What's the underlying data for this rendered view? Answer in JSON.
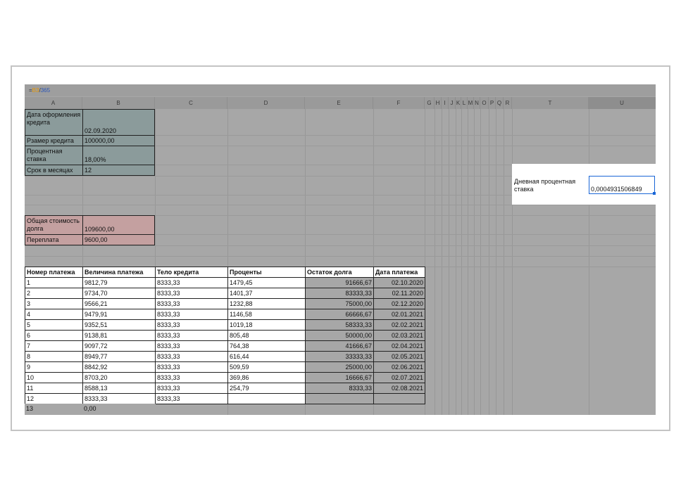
{
  "formula_bar": {
    "eq": "=",
    "ref": "B3",
    "slash": "/",
    "num": "365"
  },
  "columns": [
    "A",
    "B",
    "C",
    "D",
    "E",
    "F",
    "G",
    "H",
    "I",
    "J",
    "K",
    "L",
    "M",
    "N",
    "O",
    "P",
    "Q",
    "R",
    "T",
    "U"
  ],
  "params": {
    "date_label": "Дата оформления кредита",
    "date_value": "02.09.2020",
    "amount_label": "Рзамер кредита",
    "amount_value": "100000,00",
    "rate_label": "Процентная ставка",
    "rate_value": "18,00%",
    "term_label": "Срок в месяцах",
    "term_value": "12"
  },
  "summary": {
    "total_label": "Общая стоимость долга",
    "total_value": "109600,00",
    "overpay_label": "Переплата",
    "overpay_value": "9600,00"
  },
  "daily": {
    "label": "Дневная процентная ставка",
    "value": "0,0004931506849"
  },
  "table": {
    "headers": [
      "Номер платежа",
      "Величина платежа",
      "Тело кредита",
      "Проценты",
      "Остаток долга",
      "Дата платежа"
    ],
    "rows": [
      [
        "1",
        "9812,79",
        "8333,33",
        "1479,45",
        "91666,67",
        "02.10.2020"
      ],
      [
        "2",
        "9734,70",
        "8333,33",
        "1401,37",
        "83333,33",
        "02.11.2020"
      ],
      [
        "3",
        "9566,21",
        "8333,33",
        "1232,88",
        "75000,00",
        "02.12.2020"
      ],
      [
        "4",
        "9479,91",
        "8333,33",
        "1146,58",
        "66666,67",
        "02.01.2021"
      ],
      [
        "5",
        "9352,51",
        "8333,33",
        "1019,18",
        "58333,33",
        "02.02.2021"
      ],
      [
        "6",
        "9138,81",
        "8333,33",
        "805,48",
        "50000,00",
        "02.03.2021"
      ],
      [
        "7",
        "9097,72",
        "8333,33",
        "764,38",
        "41666,67",
        "02.04.2021"
      ],
      [
        "8",
        "8949,77",
        "8333,33",
        "616,44",
        "33333,33",
        "02.05.2021"
      ],
      [
        "9",
        "8842,92",
        "8333,33",
        "509,59",
        "25000,00",
        "02.06.2021"
      ],
      [
        "10",
        "8703,20",
        "8333,33",
        "369,86",
        "16666,67",
        "02.07.2021"
      ],
      [
        "11",
        "8588,13",
        "8333,33",
        "254,79",
        "8333,33",
        "02.08.2021"
      ],
      [
        "12",
        "8333,33",
        "8333,33",
        "",
        "",
        ""
      ],
      [
        "13",
        "0,00",
        "",
        "",
        "",
        ""
      ]
    ]
  }
}
